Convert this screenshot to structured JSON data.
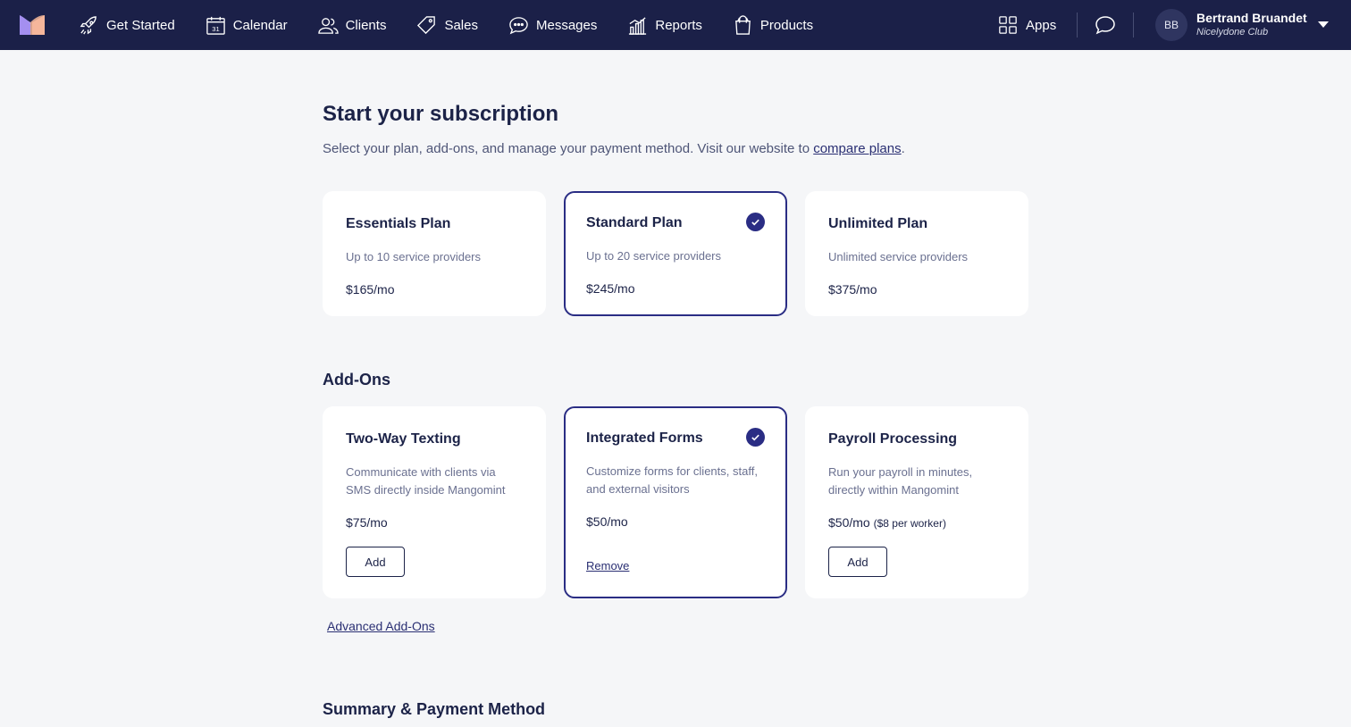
{
  "nav": {
    "items": [
      {
        "label": "Get Started",
        "icon": "rocket-icon"
      },
      {
        "label": "Calendar",
        "icon": "calendar-icon"
      },
      {
        "label": "Clients",
        "icon": "users-icon"
      },
      {
        "label": "Sales",
        "icon": "tag-icon"
      },
      {
        "label": "Messages",
        "icon": "chat-bubble-icon"
      },
      {
        "label": "Reports",
        "icon": "bar-chart-icon"
      },
      {
        "label": "Products",
        "icon": "shopping-bag-icon"
      }
    ],
    "apps_label": "Apps",
    "user": {
      "initials": "BB",
      "name": "Bertrand Bruandet",
      "club": "Nicelydone Club"
    }
  },
  "page": {
    "title": "Start your subscription",
    "subtitle_prefix": "Select your plan, add-ons, and manage your payment method. Visit our website to ",
    "subtitle_link": "compare plans",
    "subtitle_suffix": "."
  },
  "plans": [
    {
      "name": "Essentials Plan",
      "desc": "Up to 10 service providers",
      "price": "$165/mo",
      "selected": false
    },
    {
      "name": "Standard Plan",
      "desc": "Up to 20 service providers",
      "price": "$245/mo",
      "selected": true
    },
    {
      "name": "Unlimited Plan",
      "desc": "Unlimited service providers",
      "price": "$375/mo",
      "selected": false
    }
  ],
  "addons_heading": "Add-Ons",
  "addons": [
    {
      "name": "Two-Way Texting",
      "desc": "Communicate with clients via SMS directly inside Mangomint",
      "price": "$75/mo",
      "price_note": "",
      "action": "Add",
      "selected": false
    },
    {
      "name": "Integrated Forms",
      "desc": "Customize forms for clients, staff, and external visitors",
      "price": "$50/mo",
      "price_note": "",
      "action": "Remove",
      "selected": true
    },
    {
      "name": "Payroll Processing",
      "desc": "Run your payroll in minutes, directly within Mangomint",
      "price": "$50/mo",
      "price_note": "($8 per worker)",
      "action": "Add",
      "selected": false
    }
  ],
  "advanced_addons_label": "Advanced Add-Ons",
  "summary_heading": "Summary & Payment Method",
  "colors": {
    "nav_bg": "#1b2048",
    "accent": "#2a2d84",
    "page_bg": "#f5f6f8"
  }
}
